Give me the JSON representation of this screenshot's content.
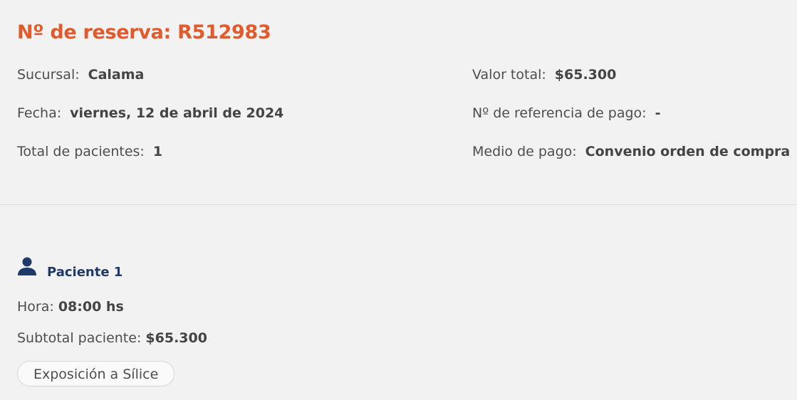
{
  "reservation": {
    "title": "Nº de reserva: R512983"
  },
  "details_left": [
    {
      "label": "Sucursal:",
      "value": "Calama"
    },
    {
      "label": "Fecha:",
      "value": "viernes, 12 de abril de 2024"
    },
    {
      "label": "Total de pacientes:",
      "value": "1"
    }
  ],
  "details_right": [
    {
      "label": "Valor total:",
      "value": "$65.300"
    },
    {
      "label": "Nº de referencia de pago:",
      "value": "-"
    },
    {
      "label": "Medio de pago:",
      "value": "Convenio orden de compra"
    }
  ],
  "patient": {
    "icon": "person-icon",
    "name": "Paciente 1",
    "hour_label": "Hora:",
    "hour_value": "08:00 hs",
    "subtotal_label": "Subtotal paciente:",
    "subtotal_value": "$65.300",
    "exam_chip": "Exposición a Sílice"
  },
  "colors": {
    "title": "#e05a2b",
    "patient_name": "#1f3a68",
    "background": "#f2f2f2"
  }
}
